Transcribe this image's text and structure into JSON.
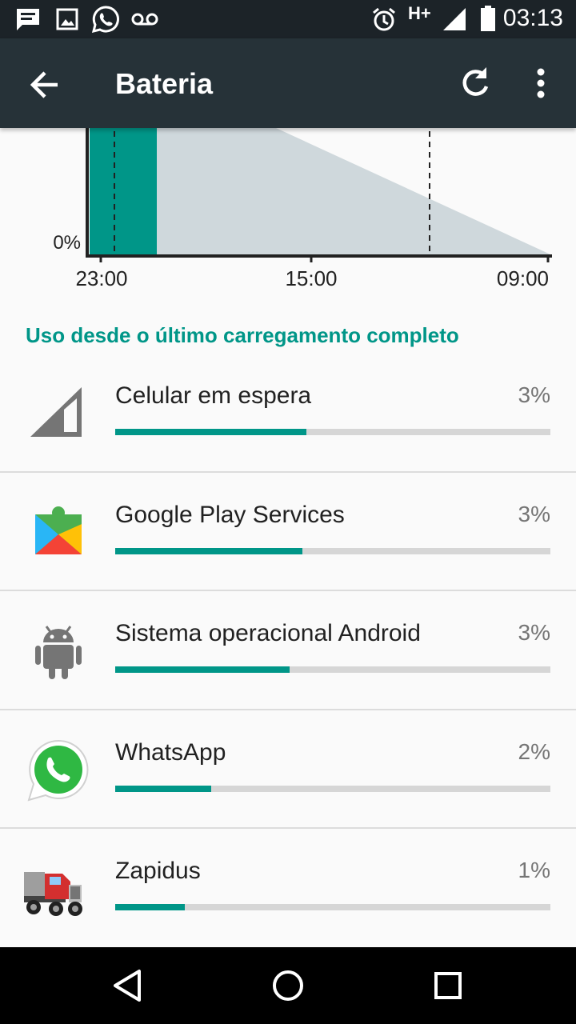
{
  "status_bar": {
    "time": "03:13",
    "network": "H+",
    "left_icons": [
      "message-icon",
      "image-icon",
      "whatsapp-icon",
      "voicemail-icon"
    ],
    "right_icons": [
      "alarm-icon",
      "signal-icon",
      "battery-icon"
    ]
  },
  "toolbar": {
    "title": "Bateria",
    "back_icon": "arrow-back-icon",
    "refresh_icon": "refresh-icon",
    "more_icon": "more-vert-icon",
    "color": "#263238"
  },
  "chart": {
    "y_label": "0%",
    "x_ticks": [
      "23:00",
      "15:00",
      "09:00"
    ],
    "usage_color": "#009688",
    "prediction_color": "#cfd8dc"
  },
  "section": {
    "header": "Uso desde o último carregamento completo",
    "accent": "#009688"
  },
  "usage": [
    {
      "name": "Celular em espera",
      "percent": "3%",
      "fill": 0.44,
      "icon": "cell-signal-icon"
    },
    {
      "name": "Google Play Services",
      "percent": "3%",
      "fill": 0.43,
      "icon": "google-play-services-icon"
    },
    {
      "name": "Sistema operacional Android",
      "percent": "3%",
      "fill": 0.4,
      "icon": "android-icon"
    },
    {
      "name": "WhatsApp",
      "percent": "2%",
      "fill": 0.22,
      "icon": "whatsapp-icon"
    },
    {
      "name": "Zapidus",
      "percent": "1%",
      "fill": 0.16,
      "icon": "truck-icon"
    }
  ],
  "nav": {
    "icons": [
      "back-triangle-icon",
      "home-circle-icon",
      "recents-square-icon"
    ]
  }
}
